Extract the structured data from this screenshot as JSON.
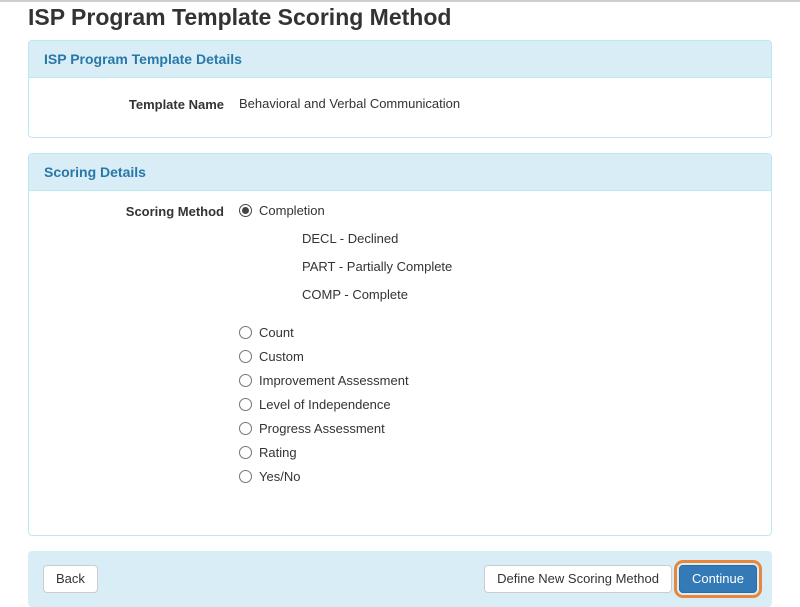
{
  "page": {
    "title": "ISP Program Template Scoring Method"
  },
  "template_details": {
    "header": "ISP Program Template Details",
    "template_name_label": "Template Name",
    "template_name_value": "Behavioral and Verbal Communication"
  },
  "scoring": {
    "header": "Scoring Details",
    "method_label": "Scoring Method",
    "options": [
      {
        "label": "Completion",
        "selected": true,
        "sublabels": [
          "DECL - Declined",
          "PART - Partially Complete",
          "COMP - Complete"
        ]
      },
      {
        "label": "Count",
        "selected": false
      },
      {
        "label": "Custom",
        "selected": false
      },
      {
        "label": "Improvement Assessment",
        "selected": false
      },
      {
        "label": "Level of Independence",
        "selected": false
      },
      {
        "label": "Progress Assessment",
        "selected": false
      },
      {
        "label": "Rating",
        "selected": false
      },
      {
        "label": "Yes/No",
        "selected": false
      }
    ]
  },
  "footer": {
    "back_label": "Back",
    "define_label": "Define New Scoring Method",
    "continue_label": "Continue"
  },
  "colors": {
    "panel_header_bg": "#d9edf7",
    "panel_border": "#bce8f1",
    "panel_header_text": "#2878a8",
    "footer_bg": "#d9edf7",
    "primary_button": "#337ab7",
    "highlight_outline": "#e8873a"
  }
}
